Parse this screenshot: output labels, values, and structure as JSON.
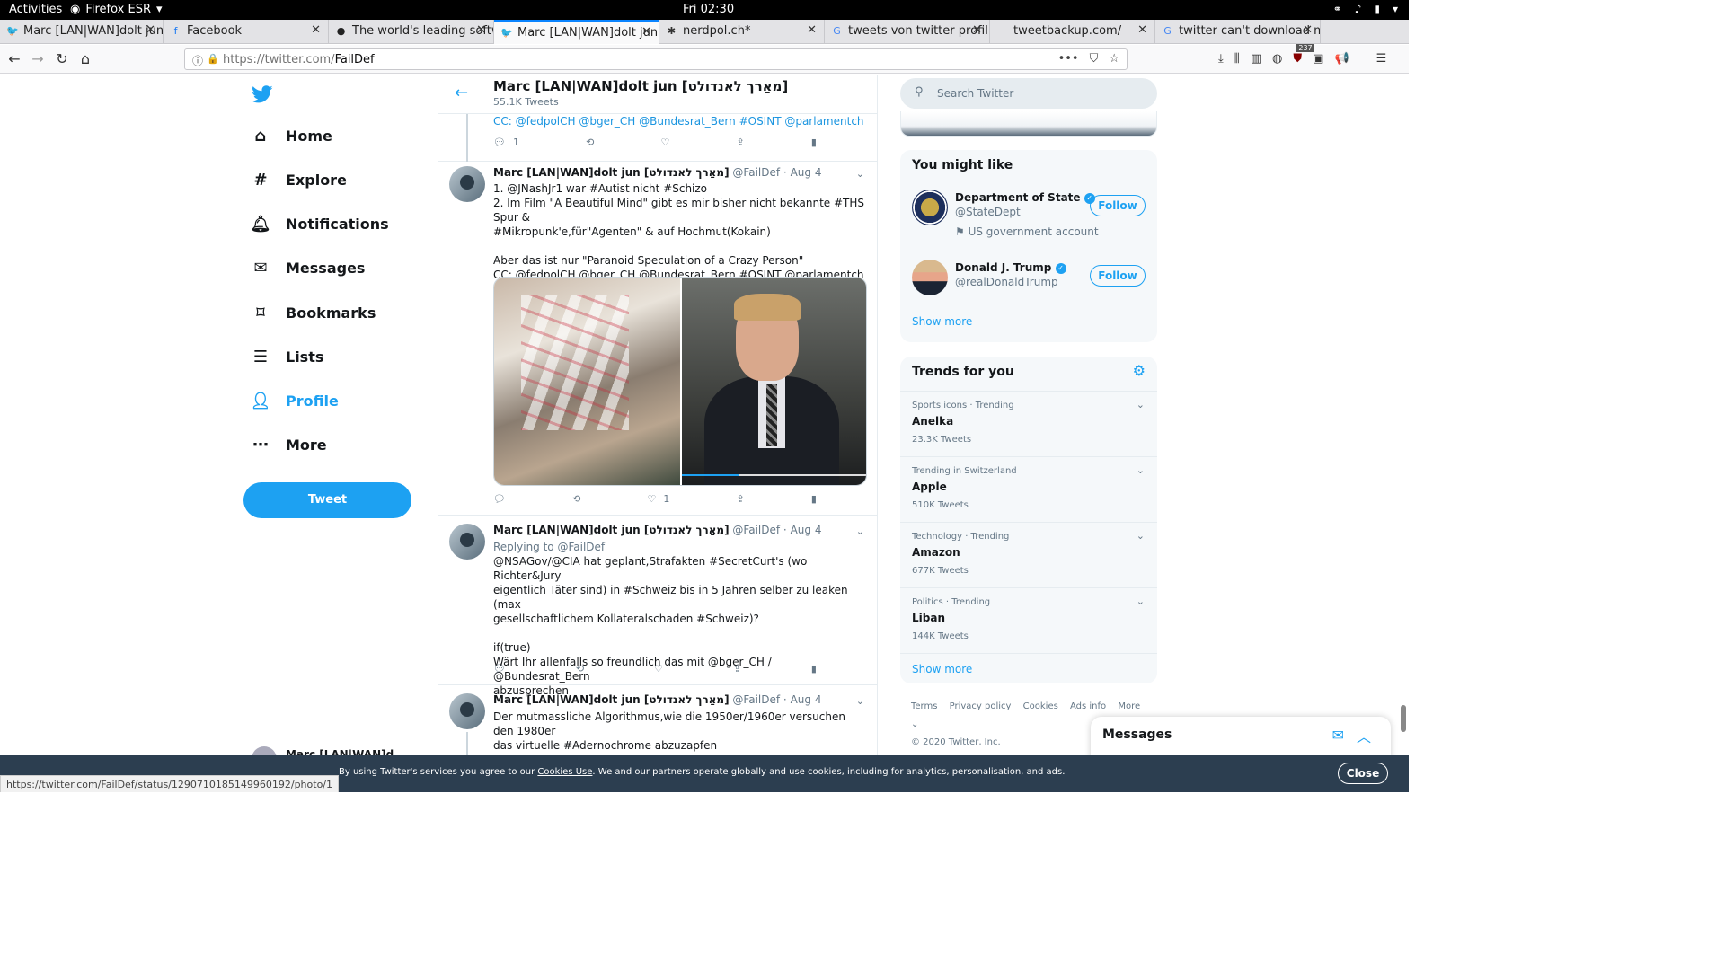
{
  "system": {
    "activities": "Activities",
    "app": "Firefox ESR",
    "clock": "Fri 02:30"
  },
  "tabs": [
    {
      "label": "Marc [LAN|WAN]dolt jun",
      "icon": "twitter-icon"
    },
    {
      "label": "Facebook",
      "icon": "facebook-icon"
    },
    {
      "label": "The world's leading softw",
      "icon": "github-icon"
    },
    {
      "label": "Marc [LAN|WAN]dolt jun",
      "icon": "twitter-icon",
      "active": true
    },
    {
      "label": "nerdpol.ch*",
      "icon": "diaspora-icon"
    },
    {
      "label": "tweets von twitter profil",
      "icon": "google-icon"
    },
    {
      "label": "tweetbackup.com/",
      "icon": ""
    },
    {
      "label": "twitter can't download m",
      "icon": "google-icon"
    }
  ],
  "address": {
    "prefix": "https://twitter.com/",
    "path": "FailDef"
  },
  "toolbar": {
    "badge": "237"
  },
  "sidebar": {
    "items": [
      {
        "label": "Home",
        "icon": "home-icon"
      },
      {
        "label": "Explore",
        "icon": "hash-icon"
      },
      {
        "label": "Notifications",
        "icon": "bell-icon"
      },
      {
        "label": "Messages",
        "icon": "envelope-icon"
      },
      {
        "label": "Bookmarks",
        "icon": "bookmark-icon"
      },
      {
        "label": "Lists",
        "icon": "list-icon"
      },
      {
        "label": "Profile",
        "icon": "person-icon"
      },
      {
        "label": "More",
        "icon": "more-icon"
      }
    ],
    "tweet_button": "Tweet",
    "user": "Marc [LAN|WAN]d"
  },
  "header": {
    "name": "Marc [LAN|WAN]dolt jun [מאַרך לאנדולט]",
    "count": "55.1K Tweets"
  },
  "tweets": [
    {
      "partial_text": "CC: @fedpolCH @bger_CH @Bundesrat_Bern #OSINT @parlamentch",
      "reply_count": "1"
    },
    {
      "name": "Marc [LAN|WAN]dolt jun [מאַרך לאנדולט]",
      "handle": "@FailDef",
      "date": "Aug 4",
      "line1": "1. @JNashJr1 war #Autist nicht #Schizo",
      "line2": "2. Im Film \"A Beautiful Mind\" gibt es mir bisher nicht bekannte #THS Spur &",
      "line3": "#Mikropunk'e,für\"Agenten\" & auf Hochmut(Kokain)",
      "line4": "Aber das ist nur \"Paranoid Speculation of a Crazy Person\"",
      "line5": "CC: @fedpolCH @bger_CH @Bundesrat_Bern #OSINT @parlamentch",
      "like_count": "1"
    },
    {
      "name": "Marc [LAN|WAN]dolt jun [מאַרך לאנדולט]",
      "handle": "@FailDef",
      "date": "Aug 4",
      "replying": "Replying to @FailDef",
      "line1": "@NSAGov/@CIA hat geplant,Strafakten #SecretCurt's (wo Richter&Jury",
      "line2": "eigentlich Täter sind) in #Schweiz bis in 5 Jahren selber zu leaken (max",
      "line3": "gesellschaftlichem Kollateralschaden #Schweiz)?",
      "line4": "if(true)",
      "line5": "Wärt Ihr allenfalls so freundlich das mit @bger_CH / @Bundesrat_Bern",
      "line6": "abzusprechen"
    },
    {
      "name": "Marc [LAN|WAN]dolt jun [מאַרך לאנדולט]",
      "handle": "@FailDef",
      "date": "Aug 4",
      "line1": "Der mutmassliche Algorithmus,wie die 1950er/1960er versuchen den 1980er",
      "line2": "das virtuelle #Adernochrome abzuzapfen"
    }
  ],
  "search": {
    "placeholder": "Search Twitter"
  },
  "you_might_like": {
    "title": "You might like",
    "accounts": [
      {
        "name": "Department of State",
        "handle": "@StateDept",
        "note": "US government account",
        "follow": "Follow"
      },
      {
        "name": "Donald J. Trump",
        "handle": "@realDonaldTrump",
        "follow": "Follow"
      }
    ],
    "show_more": "Show more"
  },
  "trends": {
    "title": "Trends for you",
    "items": [
      {
        "context": "Sports icons · Trending",
        "name": "Anelka",
        "count": "23.3K Tweets"
      },
      {
        "context": "Trending in Switzerland",
        "name": "Apple",
        "count": "510K Tweets"
      },
      {
        "context": "Technology · Trending",
        "name": "Amazon",
        "count": "677K Tweets"
      },
      {
        "context": "Politics · Trending",
        "name": "Liban",
        "count": "144K Tweets"
      }
    ],
    "show_more": "Show more"
  },
  "footer": {
    "links": [
      "Terms",
      "Privacy policy",
      "Cookies",
      "Ads info",
      "More"
    ],
    "copyright": "© 2020 Twitter, Inc."
  },
  "messages_dock": {
    "title": "Messages"
  },
  "cookie": {
    "pre": "By using Twitter's services you agree to our ",
    "link": "Cookies Use",
    "post": ". We and our partners operate globally and use cookies, including for analytics, personalisation, and ads.",
    "close": "Close"
  },
  "status_url": "https://twitter.com/FailDef/status/1290710185149960192/photo/1",
  "colors": {
    "accent": "#1da1f2",
    "cookie_bar": "#2c3e50"
  }
}
